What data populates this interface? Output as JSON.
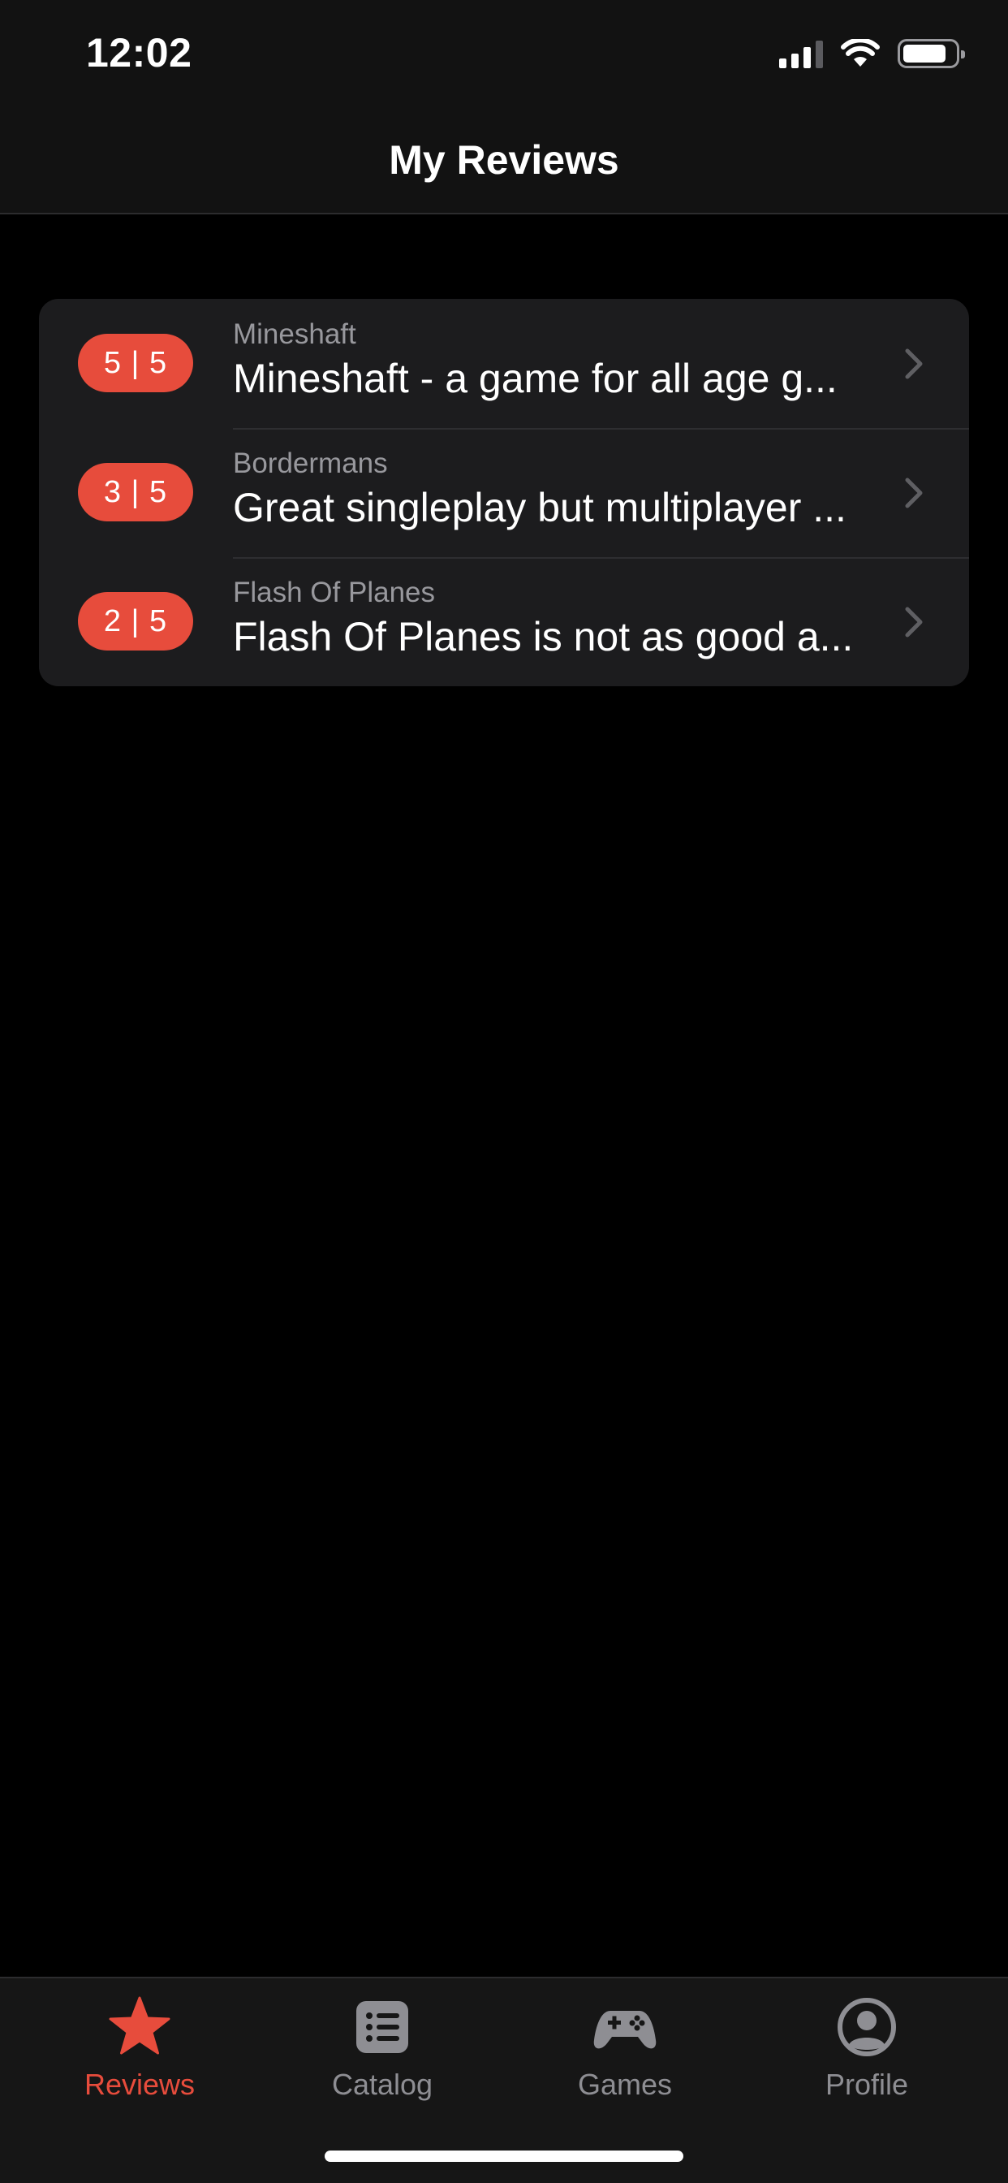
{
  "status_bar": {
    "time": "12:02"
  },
  "header": {
    "title": "My Reviews"
  },
  "colors": {
    "accent": "#e74c3c",
    "background": "#000000",
    "card": "#1c1c1e",
    "muted": "#8e8e93"
  },
  "reviews": [
    {
      "rating": "5 | 5",
      "game": "Mineshaft",
      "title": "Mineshaft - a game for all age g..."
    },
    {
      "rating": "3 | 5",
      "game": "Bordermans",
      "title": "Great singleplay but multiplayer ..."
    },
    {
      "rating": "2 | 5",
      "game": "Flash Of Planes",
      "title": "Flash Of Planes is not as good a..."
    }
  ],
  "tabs": [
    {
      "label": "Reviews",
      "icon": "star-icon",
      "active": true
    },
    {
      "label": "Catalog",
      "icon": "list-icon",
      "active": false
    },
    {
      "label": "Games",
      "icon": "gamepad-icon",
      "active": false
    },
    {
      "label": "Profile",
      "icon": "person-circle-icon",
      "active": false
    }
  ]
}
